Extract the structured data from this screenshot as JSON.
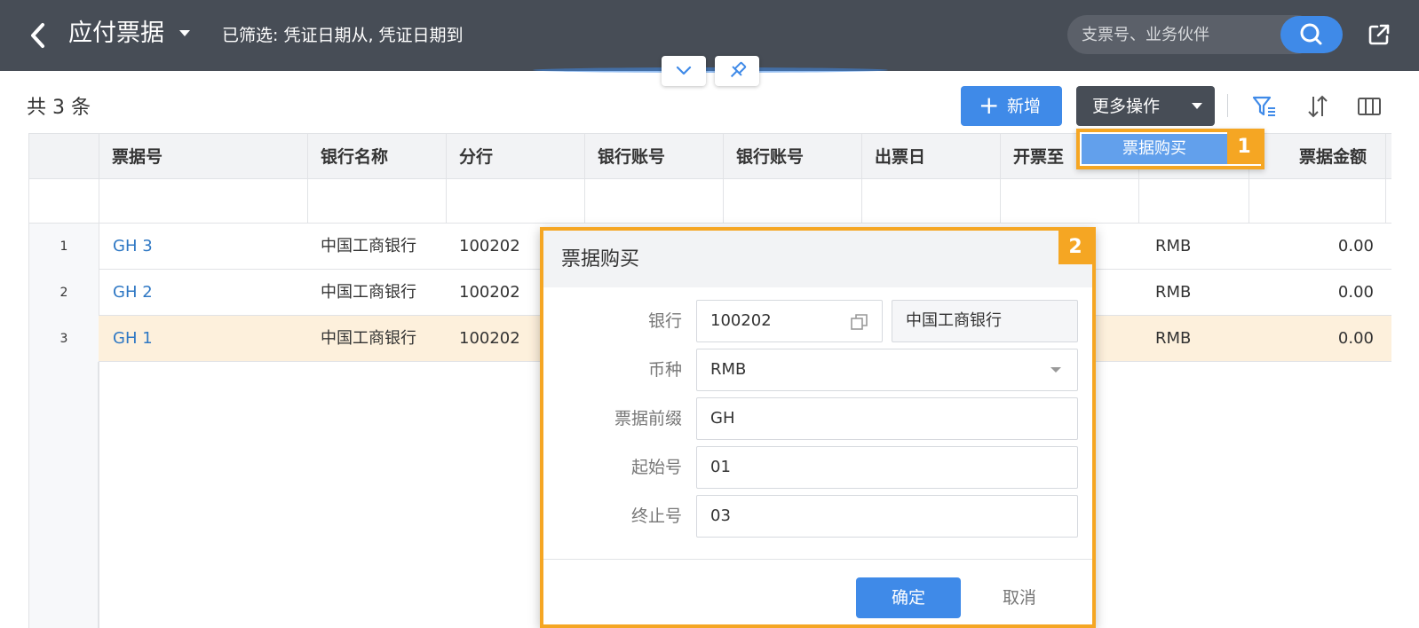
{
  "header": {
    "title": "应付票据",
    "filter_text": "已筛选: 凭证日期从, 凭证日期到",
    "search_placeholder": "支票号、业务伙伴"
  },
  "toolbar": {
    "record_count": "共 3 条",
    "new_label": "新增",
    "more_label": "更多操作"
  },
  "dropdown": {
    "items": [
      "票据购买"
    ],
    "badge": "1"
  },
  "table": {
    "columns": [
      "票据号",
      "银行名称",
      "分行",
      "银行账号",
      "银行账号",
      "出票日",
      "开票至",
      "票据金额"
    ],
    "rows": [
      {
        "num": "1",
        "bill_no": "GH 3",
        "bank": "中国工商银行",
        "branch": "100202",
        "currency": "RMB",
        "amount": "0.00"
      },
      {
        "num": "2",
        "bill_no": "GH 2",
        "bank": "中国工商银行",
        "branch": "100202",
        "currency": "RMB",
        "amount": "0.00"
      },
      {
        "num": "3",
        "bill_no": "GH 1",
        "bank": "中国工商银行",
        "branch": "100202",
        "currency": "RMB",
        "amount": "0.00"
      }
    ]
  },
  "modal": {
    "title": "票据购买",
    "badge": "2",
    "fields": {
      "bank_label": "银行",
      "bank_code": "100202",
      "bank_name": "中国工商银行",
      "currency_label": "币种",
      "currency_value": "RMB",
      "prefix_label": "票据前缀",
      "prefix_value": "GH",
      "start_label": "起始号",
      "start_value": "01",
      "end_label": "终止号",
      "end_value": "03"
    },
    "ok_label": "确定",
    "cancel_label": "取消"
  },
  "colors": {
    "topbar": "#474d56",
    "primary": "#3f8ae8",
    "highlight": "#f5a623",
    "selected_row": "#fdf0dc",
    "link": "#2f78c4"
  }
}
